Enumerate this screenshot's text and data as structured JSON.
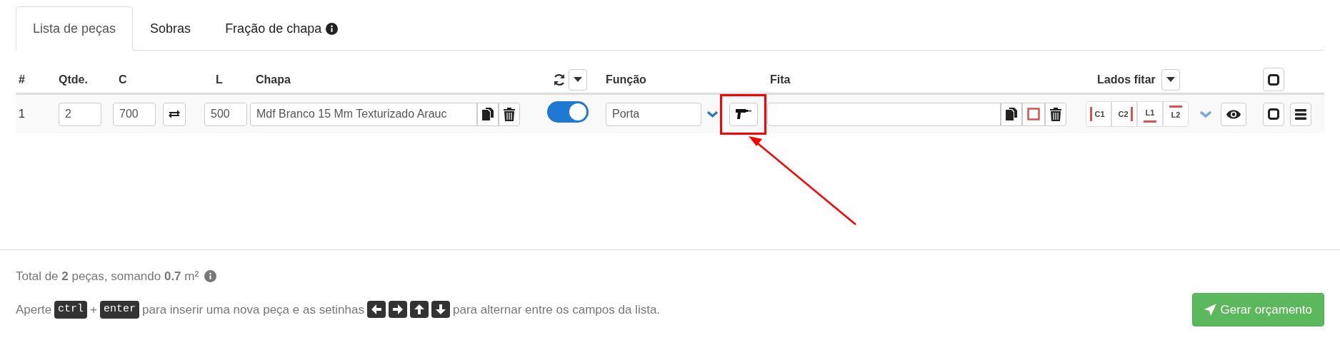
{
  "tabs": [
    {
      "label": "Lista de peças",
      "selected": true,
      "info": false
    },
    {
      "label": "Sobras",
      "selected": false,
      "info": false
    },
    {
      "label": "Fração de chapa",
      "selected": false,
      "info": true
    }
  ],
  "table": {
    "columns": [
      "#",
      "Qtde.",
      "C",
      "L",
      "Chapa",
      "Função",
      "Fita",
      "Lados fitar"
    ],
    "rows": [
      {
        "index": "1",
        "qtde": "2",
        "c": "700",
        "l": "500",
        "chapa": "Mdf Branco 15 Mm Texturizado Arauc",
        "toggle_on": true,
        "funcao": "Porta",
        "edges": [
          {
            "label": "C1",
            "kind": "left"
          },
          {
            "label": "C2",
            "kind": "right"
          },
          {
            "label": "L1",
            "kind": "bottom"
          },
          {
            "label": "L2",
            "kind": "top"
          }
        ]
      }
    ]
  },
  "footer": {
    "total": "Total de **2** peças, somando **0.7** m²",
    "help": [
      {
        "kind": "text",
        "text": "Aperte"
      },
      {
        "kind": "key",
        "text": "ctrl"
      },
      {
        "kind": "text",
        "text": "+"
      },
      {
        "kind": "key",
        "text": "enter"
      },
      {
        "kind": "text",
        "text": "para inserir uma nova peça e as setinhas"
      },
      {
        "kind": "left"
      },
      {
        "kind": "right"
      },
      {
        "kind": "up"
      },
      {
        "kind": "down"
      },
      {
        "kind": "text",
        "text": "para alternar entre os campos da lista."
      }
    ],
    "button": "Gerar orçamento"
  }
}
